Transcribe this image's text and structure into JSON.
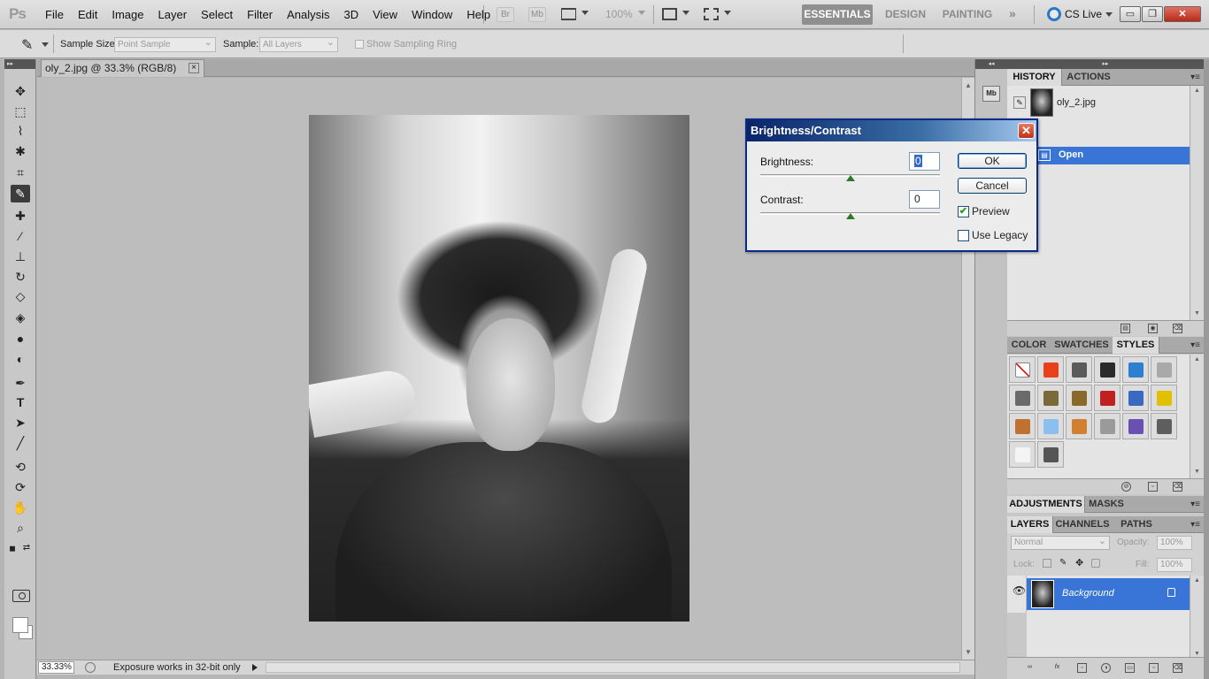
{
  "app": {
    "logo": "Ps",
    "menu": [
      "File",
      "Edit",
      "Image",
      "Layer",
      "Select",
      "Filter",
      "Analysis",
      "3D",
      "View",
      "Window",
      "Help"
    ],
    "bridge_label": "Br",
    "minibridge_label": "Mb",
    "zoom_level": "100%",
    "workspaces": [
      "ESSENTIALS",
      "DESIGN",
      "PAINTING"
    ],
    "more_label": "»",
    "cslive_label": "CS Live",
    "window_buttons": [
      "▭",
      "❐",
      "✕"
    ]
  },
  "options_bar": {
    "sample_size_label": "Sample Size:",
    "sample_size_value": "Point Sample",
    "sample_label": "Sample:",
    "sample_value": "All Layers",
    "show_ring_label": "Show Sampling Ring"
  },
  "document": {
    "tab_title": "oly_2.jpg @ 33.3% (RGB/8)",
    "tab_close": "×",
    "status_zoom": "33.33%",
    "status_text": "Exposure works in 32-bit only"
  },
  "strip": {
    "minibridge": "Mb"
  },
  "history_panel": {
    "tabs": [
      "HISTORY",
      "ACTIONS"
    ],
    "snapshot_label": "oly_2.jpg",
    "states": [
      "Open"
    ]
  },
  "styles_panel": {
    "tabs": [
      "COLOR",
      "SWATCHES",
      "STYLES"
    ],
    "swatch_colors": [
      "#ffffff",
      "#e8401a",
      "#5a5a5a",
      "#2a2a2a",
      "#2f7fd0",
      "#a9a9a9",
      "#6a6a6a",
      "#7a6a3a",
      "#8a6a2a",
      "#c02020",
      "#3a6ac0",
      "#e0c000",
      "#c07030",
      "#8ac0f0",
      "#d08030",
      "#9a9a9a",
      "#6a50b0",
      "#5e5e5e",
      "#f4f4f4",
      "#555555"
    ]
  },
  "adjustments_panel": {
    "tabs": [
      "ADJUSTMENTS",
      "MASKS"
    ]
  },
  "layers_panel": {
    "tabs": [
      "LAYERS",
      "CHANNELS",
      "PATHS"
    ],
    "blend_mode": "Normal",
    "opacity_label": "Opacity:",
    "opacity_value": "100%",
    "lock_label": "Lock:",
    "fill_label": "Fill:",
    "fill_value": "100%",
    "layers": [
      {
        "name": "Background",
        "visible": true,
        "locked": true
      }
    ]
  },
  "dialog": {
    "title": "Brightness/Contrast",
    "close": "✕",
    "brightness_label": "Brightness:",
    "brightness_value": "0",
    "contrast_label": "Contrast:",
    "contrast_value": "0",
    "ok_label": "OK",
    "cancel_label": "Cancel",
    "preview_label": "Preview",
    "preview_checked": true,
    "use_legacy_label": "Use Legacy",
    "use_legacy_checked": false
  },
  "colors": {
    "selection_blue": "#3875d7",
    "dialog_title_blue": "#0a246a",
    "active_workspace": "#8f8f8f"
  }
}
